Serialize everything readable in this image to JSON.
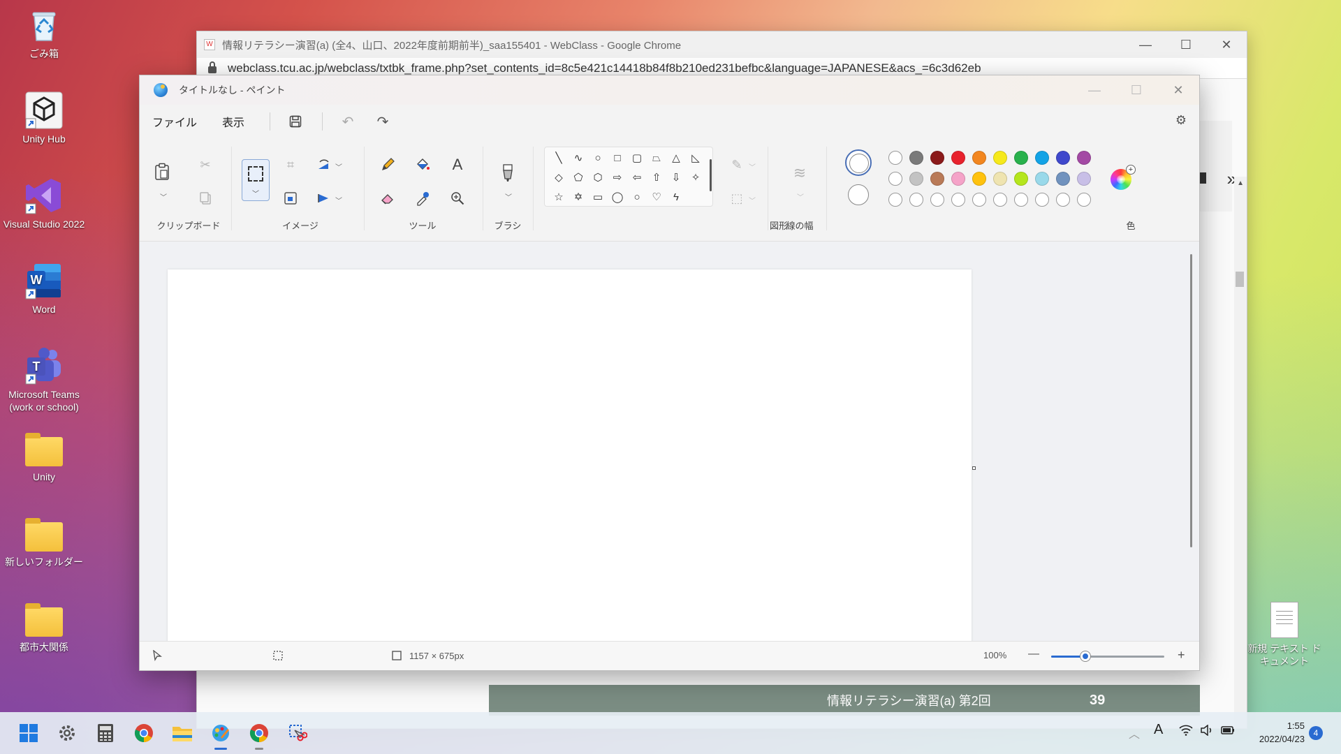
{
  "desktop": {
    "icons": [
      {
        "label": "ごみ箱",
        "icon": "recycle-bin-icon"
      },
      {
        "label": "Unity Hub",
        "icon": "unity-hub-icon"
      },
      {
        "label": "Visual Studio 2022",
        "icon": "visual-studio-icon"
      },
      {
        "label": "Word",
        "icon": "word-icon"
      },
      {
        "label": "Microsoft Teams\n(work or school)",
        "icon": "teams-icon"
      },
      {
        "label": "Unity",
        "icon": "folder-icon"
      },
      {
        "label": "新しいフォルダー",
        "icon": "folder-icon"
      },
      {
        "label": "都市大関係",
        "icon": "folder-icon"
      }
    ],
    "right_icon": {
      "label": "新規 テキスト ドキュメント",
      "icon": "text-document-icon"
    }
  },
  "chrome": {
    "title": "情報リテラシー演習(a) (全4、山口、2022年度前期前半)_saa155401 - WebClass - Google Chrome",
    "favicon_text": "W",
    "url": "webclass.tcu.ac.jp/webclass/txtbk_frame.php?set_contents_id=8c5e421c14418b84f8b210ed231befbc&language=JAPANESE&acs_=6c3d62eb",
    "slide_title": "情報リテラシー演習(a)  第2回",
    "slide_page": "39",
    "minimize": "—",
    "maximize": "☐",
    "close": "✕"
  },
  "paint": {
    "title": "タイトルなし - ペイント",
    "menu": {
      "file": "ファイル",
      "view": "表示"
    },
    "ribbon": {
      "clipboard_label": "クリップボード",
      "image_label": "イメージ",
      "tools_label": "ツール",
      "brush_label": "ブラシ",
      "shapes_label": "図形",
      "line_width_label": "線の幅",
      "color_label": "色"
    },
    "colors": {
      "row1": [
        "#ffffff",
        "#7a7a7a",
        "#8b1a1a",
        "#e8222d",
        "#f2861f",
        "#f6e91b",
        "#28b14c",
        "#12a3e6",
        "#3f48cc",
        "#a349a4"
      ],
      "row2": [
        "#ffffff",
        "#c3c3c3",
        "#b97a57",
        "#f5a3c8",
        "#ffc20e",
        "#efe4b0",
        "#b5e61d",
        "#99d9ea",
        "#7092be",
        "#c8bfe7"
      ]
    },
    "status": {
      "canvas_size": "1157 × 675px",
      "zoom": "100%",
      "zoom_level": 0.3
    }
  },
  "taskbar": {
    "time": "1:55",
    "date": "2022/04/23",
    "notification_count": "4",
    "ime": "A"
  }
}
